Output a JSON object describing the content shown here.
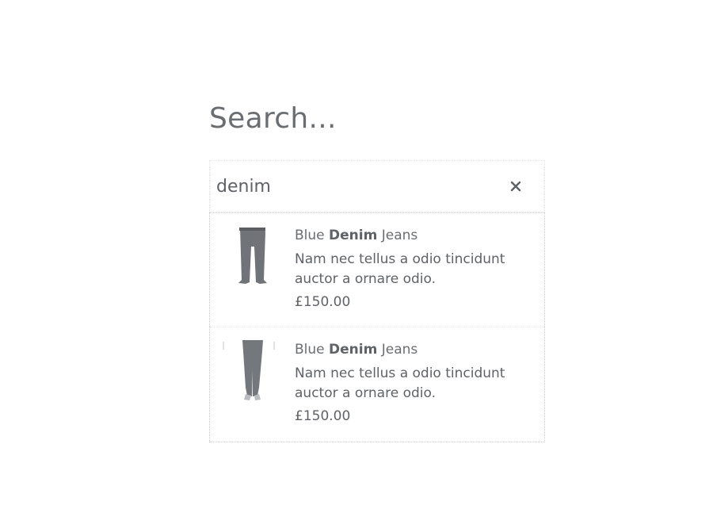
{
  "search": {
    "heading": "Search...",
    "query": "denim"
  },
  "icons": {
    "clear": "close-icon"
  },
  "colors": {
    "text": "#5f6266",
    "heading": "#6a6d71",
    "border": "#cfcfcf"
  },
  "results": [
    {
      "title_before": "Blue ",
      "title_match": "Denim",
      "title_after": " Jeans",
      "description": "Nam nec tellus a odio tincidunt auctor a ornare odio.",
      "price": "£150.00"
    },
    {
      "title_before": "Blue ",
      "title_match": "Denim",
      "title_after": " Jeans",
      "description": "Nam nec tellus a odio tincidunt auctor a ornare odio.",
      "price": "£150.00"
    }
  ]
}
